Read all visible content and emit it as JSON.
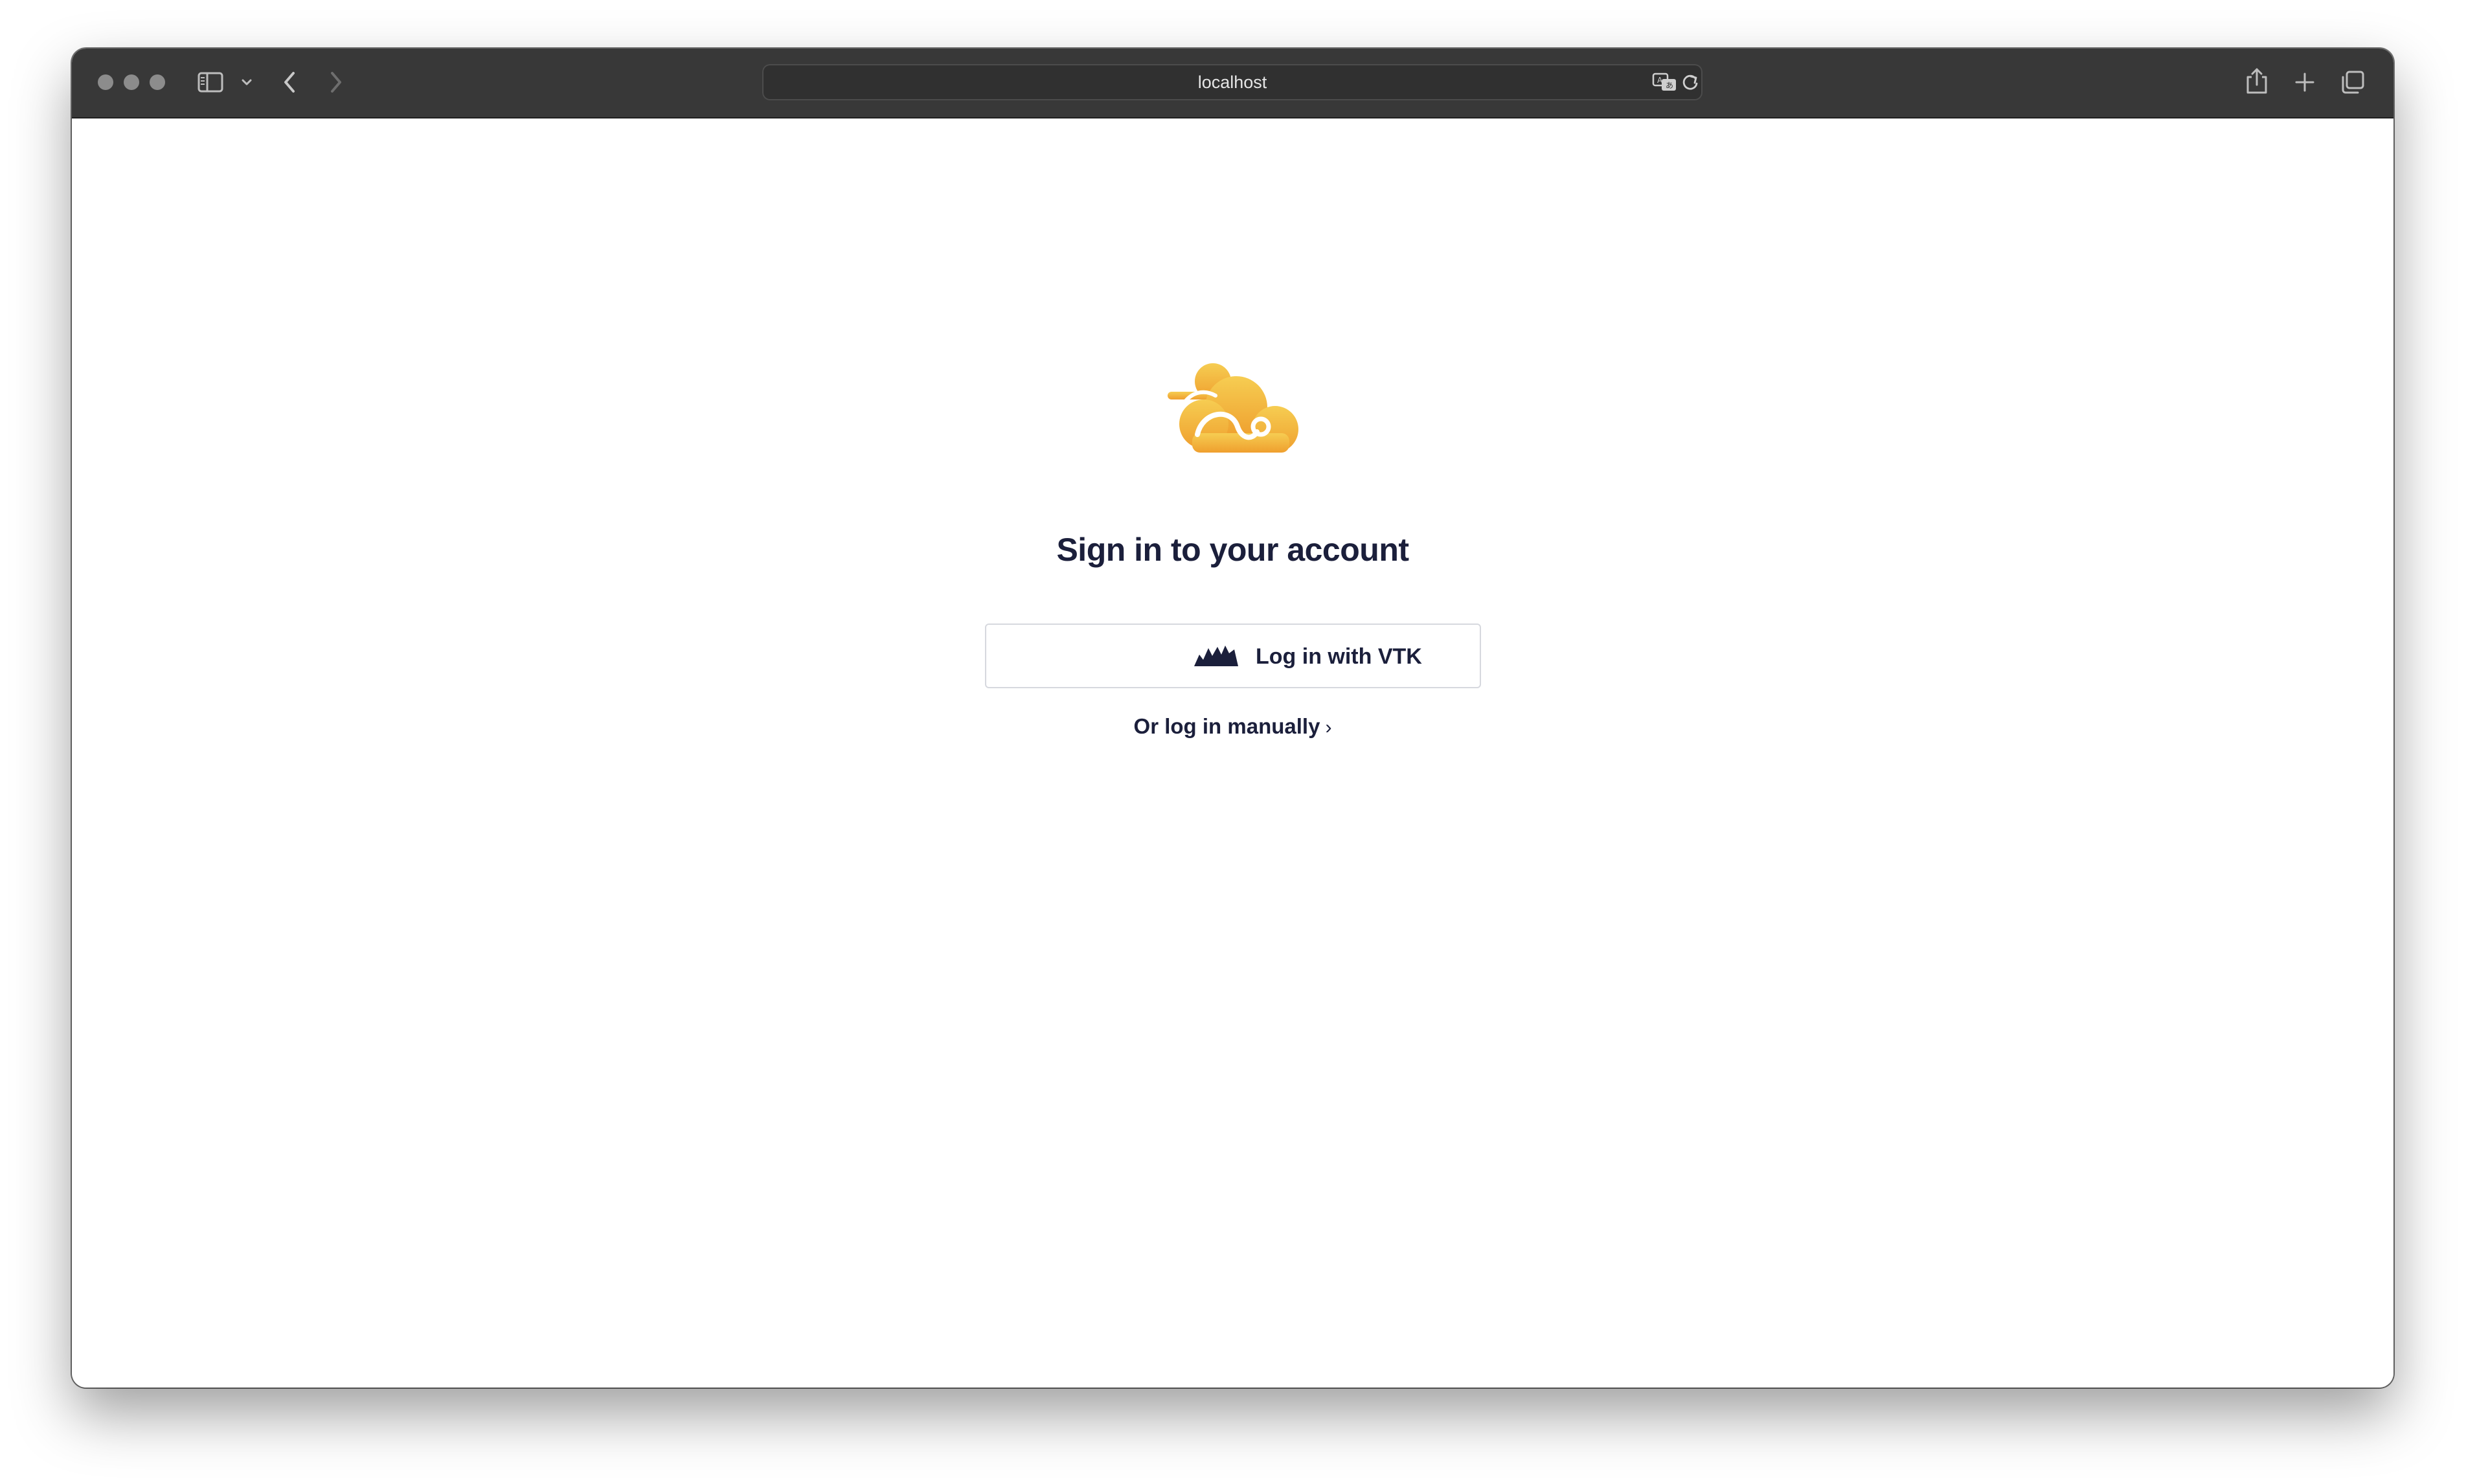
{
  "browser": {
    "address": "localhost",
    "toolbar_icons": [
      "sidebar-icon",
      "chevron-down-icon",
      "back-icon",
      "forward-icon",
      "translate-icon",
      "reload-icon",
      "share-icon",
      "new-tab-icon",
      "tabs-overview-icon"
    ]
  },
  "page": {
    "logo": "cloud-logo",
    "heading": "Sign in to your account",
    "vtk_button_label": "Log in with VTK",
    "vtk_logo": "vtk-logo",
    "manual_link_label": "Or log in manually",
    "manual_link_chevron": "›"
  },
  "colors": {
    "heading_text": "#1b1f3b",
    "logo_gradient_top": "#f5c84a",
    "logo_gradient_bottom": "#f0a634",
    "button_border": "#d6d8de",
    "toolbar_bg": "#383838"
  }
}
